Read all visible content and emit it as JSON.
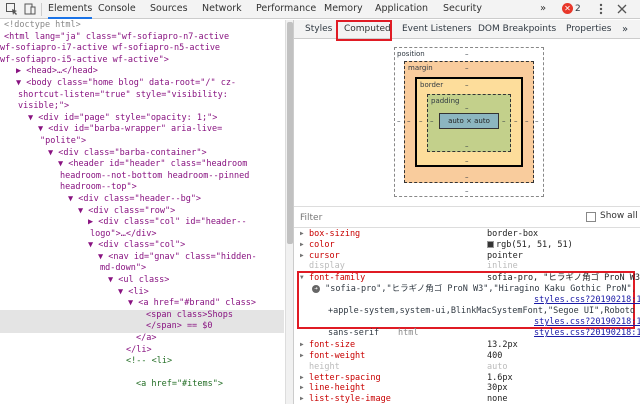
{
  "toolbar": {
    "tabs": [
      "Elements",
      "Console",
      "Sources",
      "Network",
      "Performance",
      "Memory",
      "Application",
      "Security"
    ],
    "more": "»",
    "error_count": "2"
  },
  "elements": {
    "lines": [
      {
        "t": "<!doctype html>",
        "c": "gr",
        "i": 4
      },
      {
        "t": "<html lang=\"ja\" class=\"wf-sofiapro-n7-active",
        "i": 4
      },
      {
        "t": "wf-sofiapro-i7-active wf-sofiapro-n5-active",
        "i": 0
      },
      {
        "t": "wf-sofiapro-i5-active wf-active\">",
        "i": 0
      },
      {
        "t": "▶ <head>…</head>",
        "i": 16
      },
      {
        "t": "▼ <body class=\"home blog\" data-root=\"/\" cz-",
        "i": 16
      },
      {
        "t": "shortcut-listen=\"true\" style=\"visibility:",
        "i": 18
      },
      {
        "t": "visible;\">",
        "i": 18
      },
      {
        "t": "▼ <div id=\"page\" style=\"opacity: 1;\">",
        "i": 28
      },
      {
        "t": "▼ <div id=\"barba-wrapper\" aria-live=",
        "i": 38
      },
      {
        "t": "\"polite\">",
        "i": 40
      },
      {
        "t": "▼ <div class=\"barba-container\">",
        "i": 48
      },
      {
        "t": "▼ <header id=\"header\" class=\"headroom",
        "i": 58
      },
      {
        "t": "headroom--not-bottom headroom--pinned",
        "i": 60
      },
      {
        "t": "headroom--top\">",
        "i": 60
      },
      {
        "t": "▼ <div class=\"header--bg\">",
        "i": 68
      },
      {
        "t": "▼ <div class=\"row\">",
        "i": 78
      },
      {
        "t": "▶ <div class=\"col\" id=\"header--",
        "i": 88
      },
      {
        "t": "logo\">…</div>",
        "i": 90
      },
      {
        "t": "▼ <div class=\"col\">",
        "i": 88
      },
      {
        "t": "▼ <nav id=\"gnav\" class=\"hidden-",
        "i": 98
      },
      {
        "t": "md-down\">",
        "i": 100
      },
      {
        "t": "▼ <ul class>",
        "i": 108
      },
      {
        "t": "▼ <li>",
        "i": 118
      },
      {
        "t": "▼ <a href=\"#brand\" class>",
        "i": 128
      },
      {
        "t": "<span class>Shops",
        "i": 146,
        "sel": true
      },
      {
        "t": "</span> == $0",
        "i": 146,
        "sel": true
      },
      {
        "t": "</a>",
        "i": 136
      },
      {
        "t": "</li>",
        "i": 126
      },
      {
        "t": "<!-- <li>",
        "i": 126,
        "c": "cm"
      },
      {
        "t": "",
        "i": 0
      },
      {
        "t": "<a href=\"#items\">",
        "i": 136,
        "c": "cm"
      }
    ]
  },
  "styles_pane": {
    "tabs": [
      "Styles",
      "Computed",
      "Event Listeners",
      "DOM Breakpoints",
      "Properties"
    ],
    "more": "»",
    "box_model": {
      "position_label": "position",
      "margin_label": "margin",
      "border_label": "border",
      "padding_label": "padding",
      "content": "auto × auto",
      "dash": "–"
    },
    "filter_placeholder": "Filter",
    "show_all_label": "Show all",
    "properties": [
      {
        "name": "box-sizing",
        "value": "border-box"
      },
      {
        "name": "color",
        "value": "rgb(51, 51, 51)",
        "swatch": "#333333"
      },
      {
        "name": "cursor",
        "value": "pointer"
      },
      {
        "name": "display",
        "value": "inline",
        "dim": true
      },
      {
        "name": "font-family",
        "value": "sofia-pro, \"ヒラギノ角ゴ ProN W3\"…",
        "open": true
      },
      {
        "name": "font-size",
        "value": "13.2px"
      },
      {
        "name": "font-weight",
        "value": "400"
      },
      {
        "name": "height",
        "value": "auto",
        "dim": true
      },
      {
        "name": "letter-spacing",
        "value": "1.6px"
      },
      {
        "name": "line-height",
        "value": "30px"
      },
      {
        "name": "list-style-image",
        "value": "none"
      }
    ],
    "font_family_detail": {
      "line1": "\"sofia-pro\",\"ヒラギノ角ゴ ProN W3\",\"Hiragino Kaku Gothic ProN\",",
      "link1": "styles.css?20190218:1",
      "line2": "+apple-system,system-ui,BlinkMacSystemFont,\"Segoe UI\",Roboto,",
      "link2": "styles.css?20190218:1",
      "line3a": "sans-serif",
      "line3b": "html",
      "link3": "styles.css?20190218:1"
    }
  }
}
